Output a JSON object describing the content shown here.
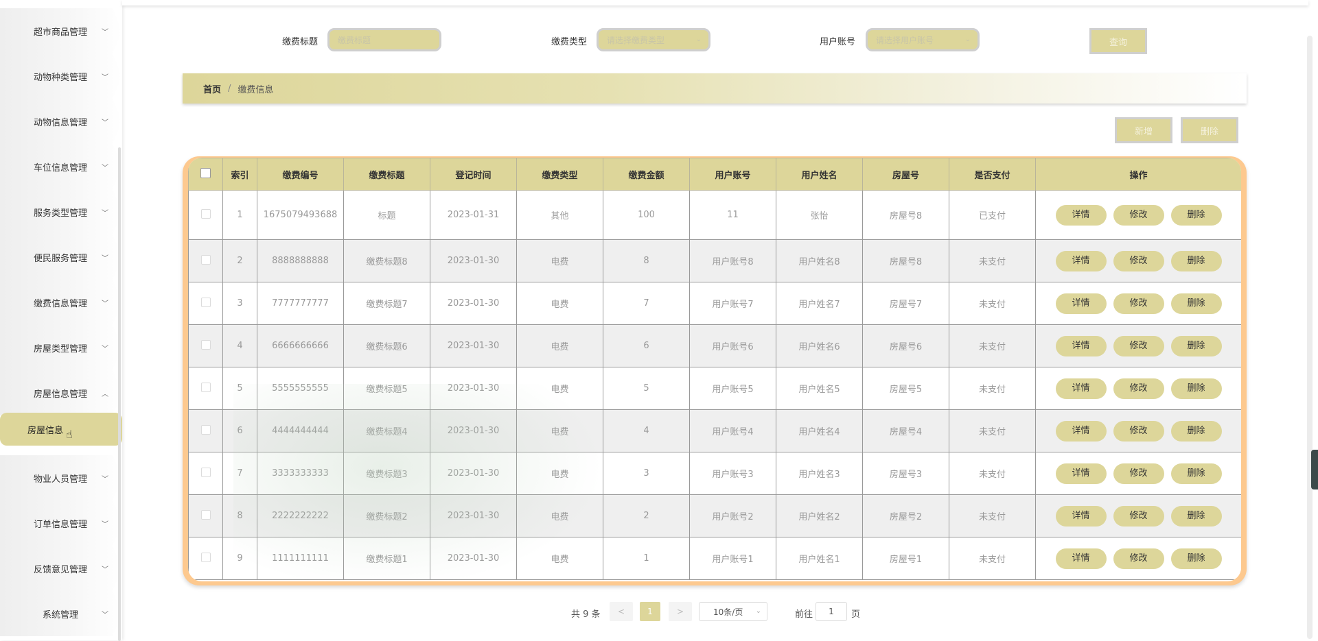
{
  "sidebar": {
    "items": [
      {
        "label": "超市商品管理"
      },
      {
        "label": "动物种类管理"
      },
      {
        "label": "动物信息管理"
      },
      {
        "label": "车位信息管理"
      },
      {
        "label": "服务类型管理"
      },
      {
        "label": "便民服务管理"
      },
      {
        "label": "缴费信息管理"
      },
      {
        "label": "房屋类型管理"
      },
      {
        "label": "房屋信息管理"
      },
      {
        "label": "物业人员管理"
      },
      {
        "label": "订单信息管理"
      },
      {
        "label": "反馈意见管理"
      },
      {
        "label": "系统管理"
      }
    ],
    "active_sub": "房屋信息"
  },
  "search": {
    "title_label": "缴费标题",
    "title_placeholder": "缴费标题",
    "type_label": "缴费类型",
    "type_placeholder": "请选择缴费类型",
    "account_label": "用户账号",
    "account_placeholder": "请选择用户账号",
    "query_button": "查询"
  },
  "breadcrumb": {
    "home": "首页",
    "separator": "/",
    "current": "缴费信息"
  },
  "actions": {
    "add": "新增",
    "delete": "删除"
  },
  "table": {
    "headers": [
      "索引",
      "缴费编号",
      "缴费标题",
      "登记时间",
      "缴费类型",
      "缴费金额",
      "用户账号",
      "用户姓名",
      "房屋号",
      "是否支付",
      "操作"
    ],
    "rows": [
      {
        "index": "1",
        "code": "1675079493688",
        "title": "标题",
        "time": "2023-01-31",
        "type": "其他",
        "amount": "100",
        "account": "11",
        "name": "张怡",
        "house": "房屋号8",
        "paid": "已支付"
      },
      {
        "index": "2",
        "code": "8888888888",
        "title": "缴费标题8",
        "time": "2023-01-30",
        "type": "电费",
        "amount": "8",
        "account": "用户账号8",
        "name": "用户姓名8",
        "house": "房屋号8",
        "paid": "未支付"
      },
      {
        "index": "3",
        "code": "7777777777",
        "title": "缴费标题7",
        "time": "2023-01-30",
        "type": "电费",
        "amount": "7",
        "account": "用户账号7",
        "name": "用户姓名7",
        "house": "房屋号7",
        "paid": "未支付"
      },
      {
        "index": "4",
        "code": "6666666666",
        "title": "缴费标题6",
        "time": "2023-01-30",
        "type": "电费",
        "amount": "6",
        "account": "用户账号6",
        "name": "用户姓名6",
        "house": "房屋号6",
        "paid": "未支付"
      },
      {
        "index": "5",
        "code": "5555555555",
        "title": "缴费标题5",
        "time": "2023-01-30",
        "type": "电费",
        "amount": "5",
        "account": "用户账号5",
        "name": "用户姓名5",
        "house": "房屋号5",
        "paid": "未支付"
      },
      {
        "index": "6",
        "code": "4444444444",
        "title": "缴费标题4",
        "time": "2023-01-30",
        "type": "电费",
        "amount": "4",
        "account": "用户账号4",
        "name": "用户姓名4",
        "house": "房屋号4",
        "paid": "未支付"
      },
      {
        "index": "7",
        "code": "3333333333",
        "title": "缴费标题3",
        "time": "2023-01-30",
        "type": "电费",
        "amount": "3",
        "account": "用户账号3",
        "name": "用户姓名3",
        "house": "房屋号3",
        "paid": "未支付"
      },
      {
        "index": "8",
        "code": "2222222222",
        "title": "缴费标题2",
        "time": "2023-01-30",
        "type": "电费",
        "amount": "2",
        "account": "用户账号2",
        "name": "用户姓名2",
        "house": "房屋号2",
        "paid": "未支付"
      },
      {
        "index": "9",
        "code": "1111111111",
        "title": "缴费标题1",
        "time": "2023-01-30",
        "type": "电费",
        "amount": "1",
        "account": "用户账号1",
        "name": "用户姓名1",
        "house": "房屋号1",
        "paid": "未支付"
      }
    ],
    "row_actions": {
      "detail": "详情",
      "edit": "修改",
      "delete": "删除"
    }
  },
  "pagination": {
    "total": "共 9 条",
    "prev": "<",
    "current_page": "1",
    "next": ">",
    "page_size": "10条/页",
    "goto_prefix": "前往",
    "goto_value": "1",
    "goto_suffix": "页"
  },
  "colors": {
    "accent": "#ddd69a",
    "table_border": "#fdc98f",
    "row_alt": "#efefef"
  }
}
